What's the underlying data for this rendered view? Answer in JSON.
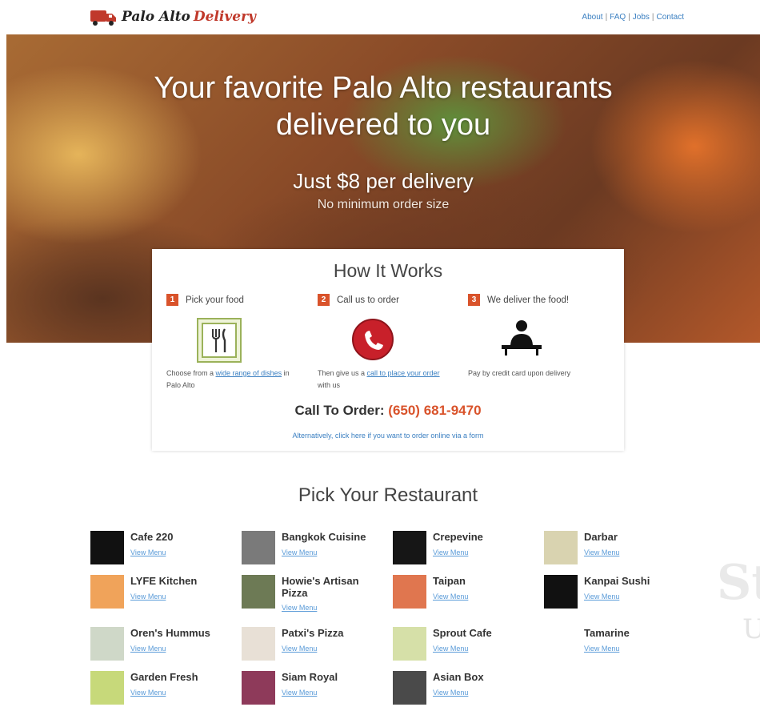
{
  "header": {
    "brand_part1": "Palo Alto",
    "brand_part2": "Delivery",
    "nav": [
      "About",
      "FAQ",
      "Jobs",
      "Contact"
    ]
  },
  "hero": {
    "title_line1": "Your favorite Palo Alto restaurants",
    "title_line2": "delivered to you",
    "price": "Just $8 per delivery",
    "minimum": "No minimum order size"
  },
  "how": {
    "title": "How It Works",
    "steps": [
      {
        "num": "1",
        "label": "Pick your food",
        "desc_pre": "Choose from a ",
        "desc_link": "wide range of dishes",
        "desc_post": " in Palo Alto",
        "icon": "fork-knife-icon"
      },
      {
        "num": "2",
        "label": "Call us to order",
        "desc_pre": "Then give us a ",
        "desc_link": "call to place your order",
        "desc_post": " with us",
        "icon": "phone-icon"
      },
      {
        "num": "3",
        "label": "We deliver the food!",
        "desc_pre": "Pay by credit card upon delivery",
        "desc_link": "",
        "desc_post": "",
        "icon": "person-desk-icon"
      }
    ],
    "call_label": "Call To Order:",
    "phone": "(650) 681-9470",
    "alternative": "Alternatively, click here if you want to order online via a form"
  },
  "restaurants": {
    "title": "Pick Your Restaurant",
    "view_menu": "View Menu",
    "items": [
      {
        "name": "Cafe 220",
        "color": "#111111"
      },
      {
        "name": "Bangkok Cuisine",
        "color": "#7a7a7a"
      },
      {
        "name": "Crepevine",
        "color": "#161616"
      },
      {
        "name": "Darbar",
        "color": "#d9d3b0"
      },
      {
        "name": "LYFE Kitchen",
        "color": "#f0a35a"
      },
      {
        "name": "Howie's Artisan Pizza",
        "color": "#6d7a55"
      },
      {
        "name": "Taipan",
        "color": "#e0764f"
      },
      {
        "name": "Kanpai Sushi",
        "color": "#111111"
      },
      {
        "name": "Oren's Hummus",
        "color": "#cfd8c8"
      },
      {
        "name": "Patxi's Pizza",
        "color": "#e8e0d6"
      },
      {
        "name": "Sprout Cafe",
        "color": "#d6e0a8"
      },
      {
        "name": "Tamarine",
        "color": "#ffffff"
      },
      {
        "name": "Garden Fresh",
        "color": "#c7d97a"
      },
      {
        "name": "Siam Royal",
        "color": "#8e3a5a"
      },
      {
        "name": "Asian Box",
        "color": "#4a4a4a"
      }
    ]
  },
  "watermark": {
    "line1": "St",
    "line2": "U"
  }
}
